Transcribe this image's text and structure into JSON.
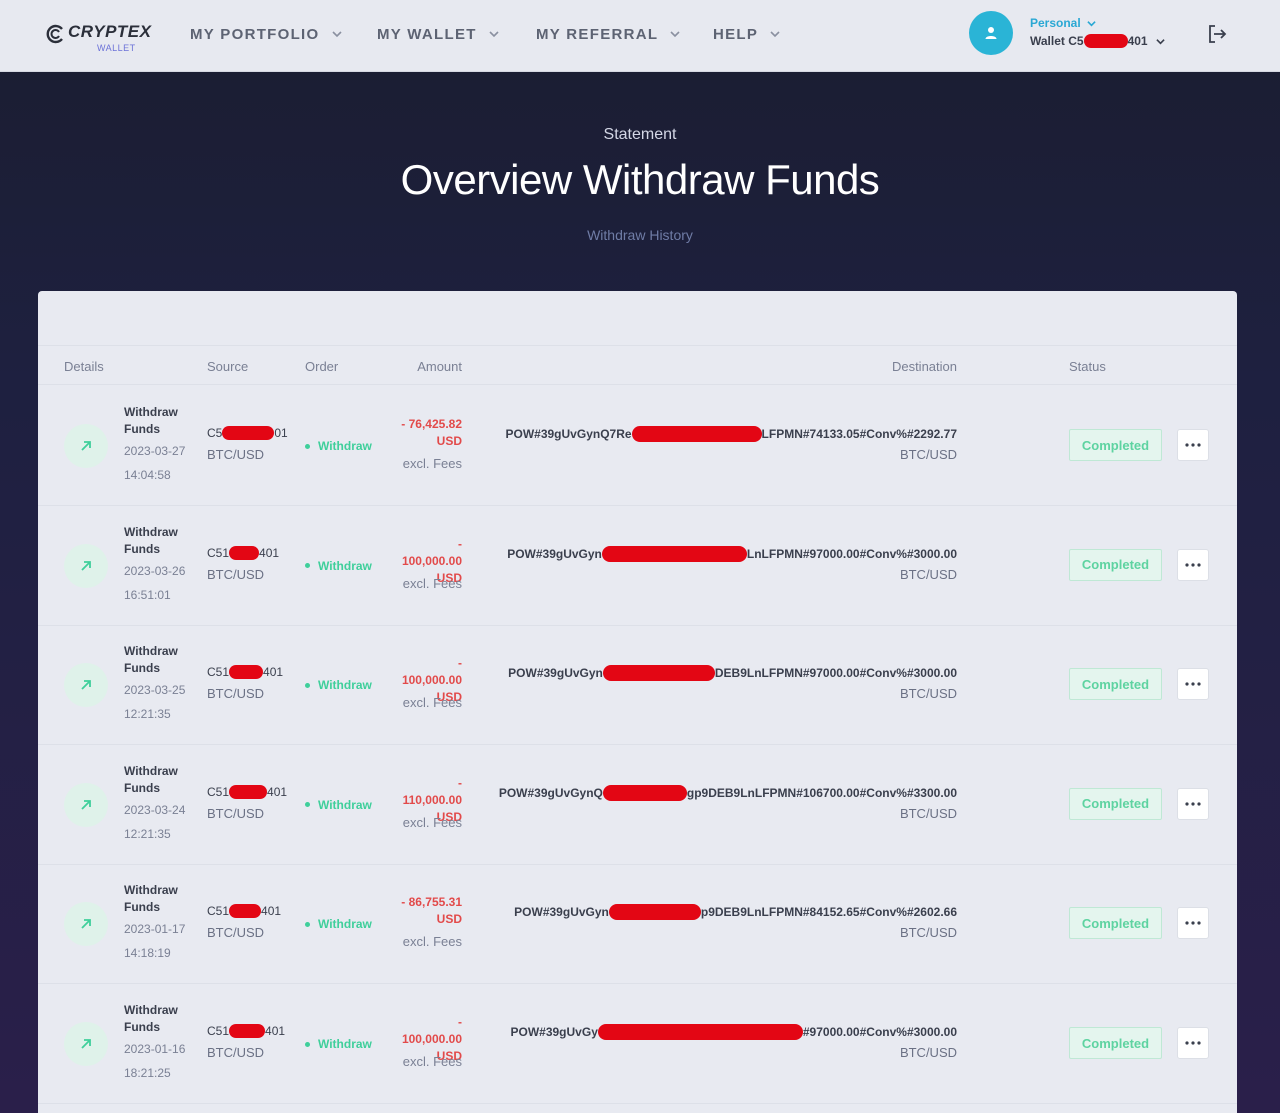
{
  "brand": {
    "name": "CRYPTEX",
    "sub": "WALLET"
  },
  "nav": [
    {
      "label": "MY PORTFOLIO"
    },
    {
      "label": "MY WALLET"
    },
    {
      "label": "MY REFERRAL"
    },
    {
      "label": "HELP"
    }
  ],
  "user": {
    "type": "Personal",
    "wallet_prefix": "Wallet C5",
    "wallet_suffix": "401"
  },
  "hero": {
    "label": "Statement",
    "title": "Overview Withdraw Funds",
    "subtitle": "Withdraw History"
  },
  "table": {
    "headers": {
      "details": "Details",
      "source": "Source",
      "order": "Order",
      "amount": "Amount",
      "destination": "Destination",
      "status": "Status"
    },
    "rows": [
      {
        "title": "Withdraw Funds",
        "date": "2023-03-27",
        "time": "14:04:58",
        "src_prefix": "C5",
        "src_suffix": "01",
        "pair": "BTC/USD",
        "order": "Withdraw",
        "amount": "- 76,425.82",
        "currency": "USD",
        "fees": "excl. Fees",
        "dest_prefix": "POW#39gUvGynQ7Re",
        "dest_suffix": "LFPMN#74133.05#Conv%#2292.77",
        "dest_pair": "BTC/USD",
        "status": "Completed"
      },
      {
        "title": "Withdraw Funds",
        "date": "2023-03-26",
        "time": "16:51:01",
        "src_prefix": "C51",
        "src_suffix": "401",
        "pair": "BTC/USD",
        "order": "Withdraw",
        "amount": "-\n100,000.00",
        "currency": "USD",
        "fees": "excl. Fees",
        "dest_prefix": "POW#39gUvGyn",
        "dest_suffix": "LnLFPMN#97000.00#Conv%#3000.00",
        "dest_pair": "BTC/USD",
        "status": "Completed"
      },
      {
        "title": "Withdraw Funds",
        "date": "2023-03-25",
        "time": "12:21:35",
        "src_prefix": "C51",
        "src_suffix": "401",
        "pair": "BTC/USD",
        "order": "Withdraw",
        "amount": "-\n100,000.00",
        "currency": "USD",
        "fees": "excl. Fees",
        "dest_prefix": "POW#39gUvGyn",
        "dest_suffix": "DEB9LnLFPMN#97000.00#Conv%#3000.00",
        "dest_pair": "BTC/USD",
        "status": "Completed"
      },
      {
        "title": "Withdraw Funds",
        "date": "2023-03-24",
        "time": "12:21:35",
        "src_prefix": "C51",
        "src_suffix": "401",
        "pair": "BTC/USD",
        "order": "Withdraw",
        "amount": "-\n110,000.00",
        "currency": "USD",
        "fees": "excl. Fees",
        "dest_prefix": "POW#39gUvGynQ",
        "dest_suffix": "gp9DEB9LnLFPMN#106700.00#Conv%#3300.00",
        "dest_pair": "BTC/USD",
        "status": "Completed"
      },
      {
        "title": "Withdraw Funds",
        "date": "2023-01-17",
        "time": "14:18:19",
        "src_prefix": "C51",
        "src_suffix": "401",
        "pair": "BTC/USD",
        "order": "Withdraw",
        "amount": "- 86,755.31",
        "currency": "USD",
        "fees": "excl. Fees",
        "dest_prefix": "POW#39gUvGyn",
        "dest_suffix": "p9DEB9LnLFPMN#84152.65#Conv%#2602.66",
        "dest_pair": "BTC/USD",
        "status": "Completed"
      },
      {
        "title": "Withdraw Funds",
        "date": "2023-01-16",
        "time": "18:21:25",
        "src_prefix": "C51",
        "src_suffix": "401",
        "pair": "BTC/USD",
        "order": "Withdraw",
        "amount": "-\n100,000.00",
        "currency": "USD",
        "fees": "excl. Fees",
        "dest_prefix": "POW#39gUvGy",
        "dest_suffix": "#97000.00#Conv%#3000.00",
        "dest_pair": "BTC/USD",
        "status": "Completed"
      }
    ]
  },
  "colors": {
    "accent": "#2ab4d6",
    "success": "#3fcf9b",
    "negative": "#e24a4a",
    "redaction": "#e30614"
  },
  "icons": {
    "row": "arrow-up-right-icon",
    "logout": "logout-icon",
    "more": "more-horizontal-icon",
    "avatar": "user-icon"
  }
}
